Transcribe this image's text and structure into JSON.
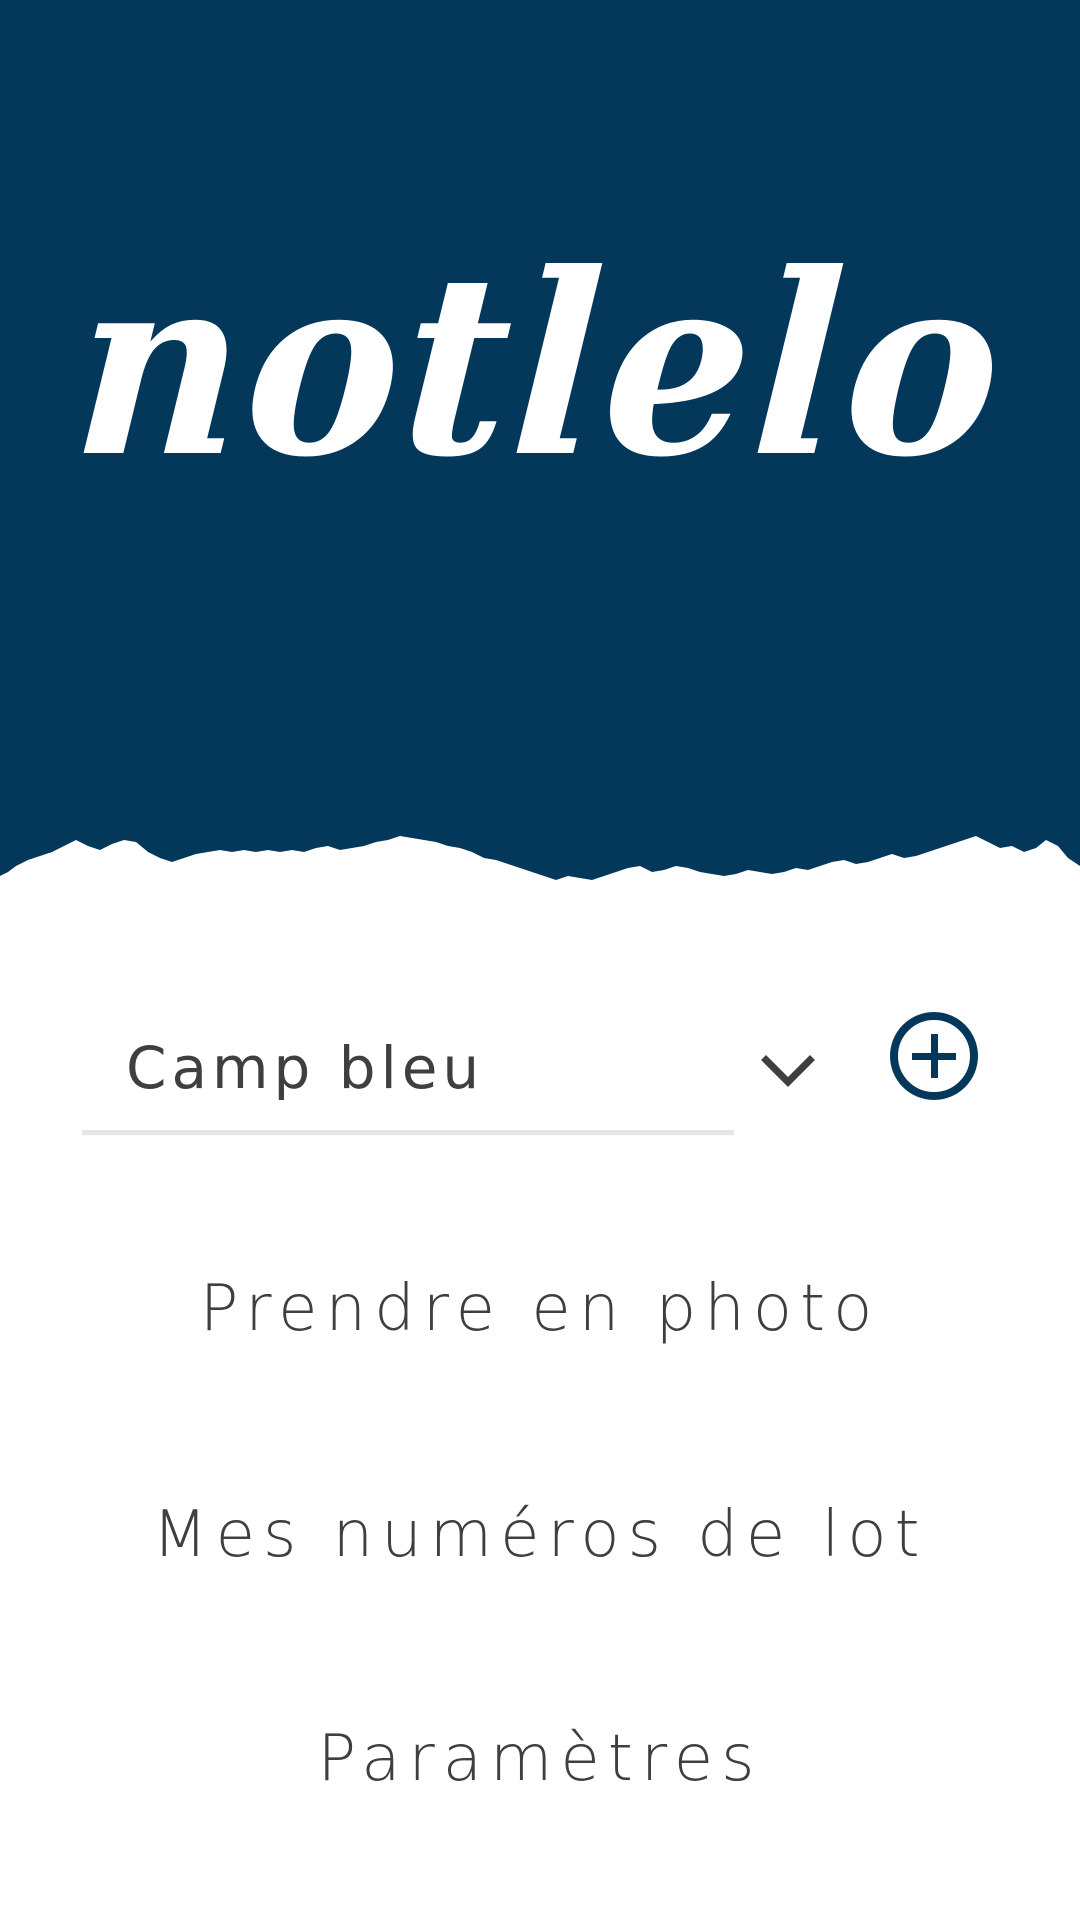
{
  "app": {
    "logo_text": "notlelo",
    "brand_color": "#03385b"
  },
  "selector": {
    "value": "Camp bleu",
    "dropdown_icon": "chevron-down-icon",
    "add_icon": "plus-circle-icon"
  },
  "menu": {
    "items": [
      {
        "label": "Prendre en photo"
      },
      {
        "label": "Mes numéros de lot"
      },
      {
        "label": "Paramètres"
      }
    ]
  }
}
